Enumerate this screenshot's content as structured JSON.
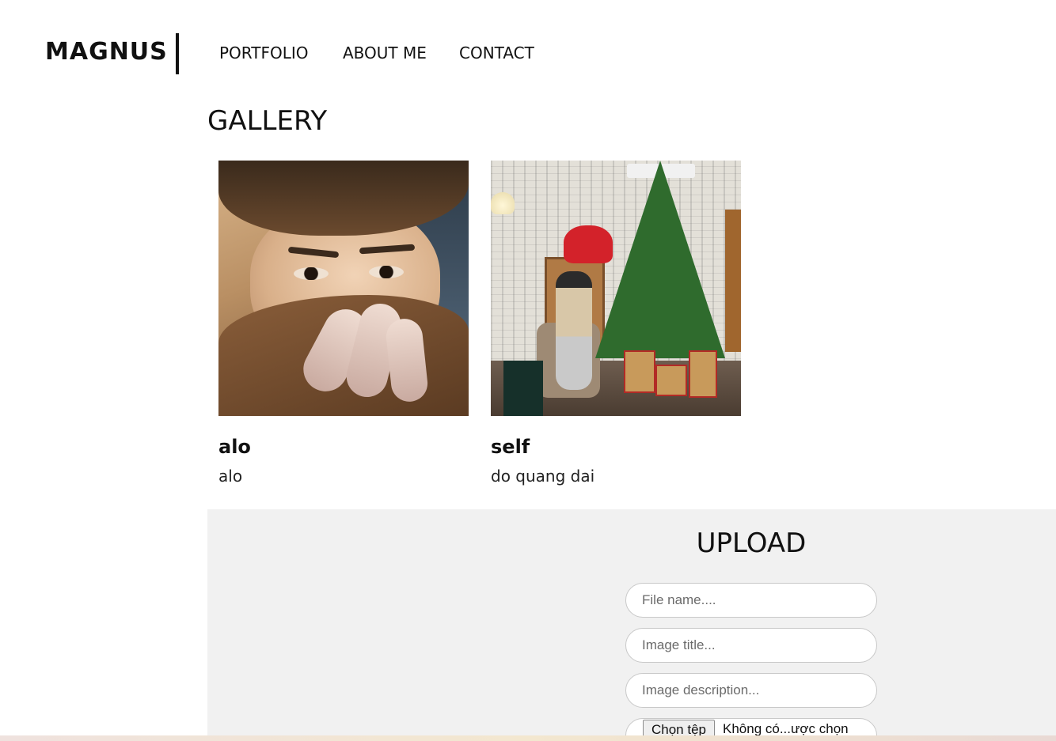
{
  "header": {
    "logo": "MAGNUS",
    "nav": [
      {
        "label": "PORTFOLIO"
      },
      {
        "label": "ABOUT ME"
      },
      {
        "label": "CONTACT"
      }
    ]
  },
  "gallery": {
    "title": "GALLERY",
    "items": [
      {
        "title": "alo",
        "description": "alo"
      },
      {
        "title": "self",
        "description": "do quang dai"
      }
    ]
  },
  "upload": {
    "title": "UPLOAD",
    "fields": [
      {
        "placeholder": "File name...."
      },
      {
        "placeholder": "Image title..."
      },
      {
        "placeholder": "Image description..."
      }
    ],
    "file_button": "Chọn tệp",
    "file_status": "Không có...ược chọn"
  }
}
